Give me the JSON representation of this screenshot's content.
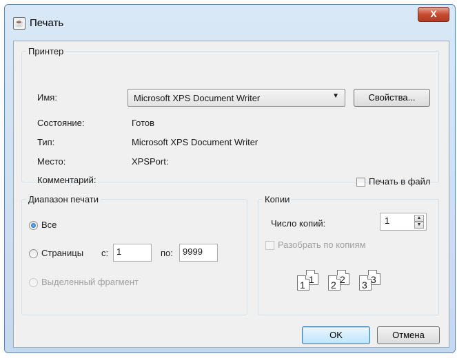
{
  "window": {
    "title": "Печать",
    "close_glyph": "X",
    "icon": "java-app-icon"
  },
  "printer": {
    "group_label": "Принтер",
    "name_label": "Имя:",
    "selected_printer": "Microsoft XPS Document Writer",
    "properties_button": "Свойства...",
    "status_label": "Состояние:",
    "status_value": "Готов",
    "type_label": "Тип:",
    "type_value": "Microsoft XPS Document Writer",
    "location_label": "Место:",
    "location_value": "XPSPort:",
    "comment_label": "Комментарий:",
    "print_to_file_label": "Печать в файл",
    "print_to_file_checked": false
  },
  "range": {
    "group_label": "Диапазон печати",
    "all_label": "Все",
    "pages_label": "Страницы",
    "from_label": "с:",
    "from_value": "1",
    "to_label": "по:",
    "to_value": "9999",
    "selection_label": "Выделенный фрагмент",
    "selected_option": "all"
  },
  "copies": {
    "group_label": "Копии",
    "count_label": "Число копий:",
    "count_value": "1",
    "collate_label": "Разобрать по копиям",
    "collate_enabled": false,
    "collate_pages": [
      [
        "1",
        "1"
      ],
      [
        "2",
        "2"
      ],
      [
        "3",
        "3"
      ]
    ]
  },
  "buttons": {
    "ok": "OK",
    "cancel": "Отмена"
  }
}
